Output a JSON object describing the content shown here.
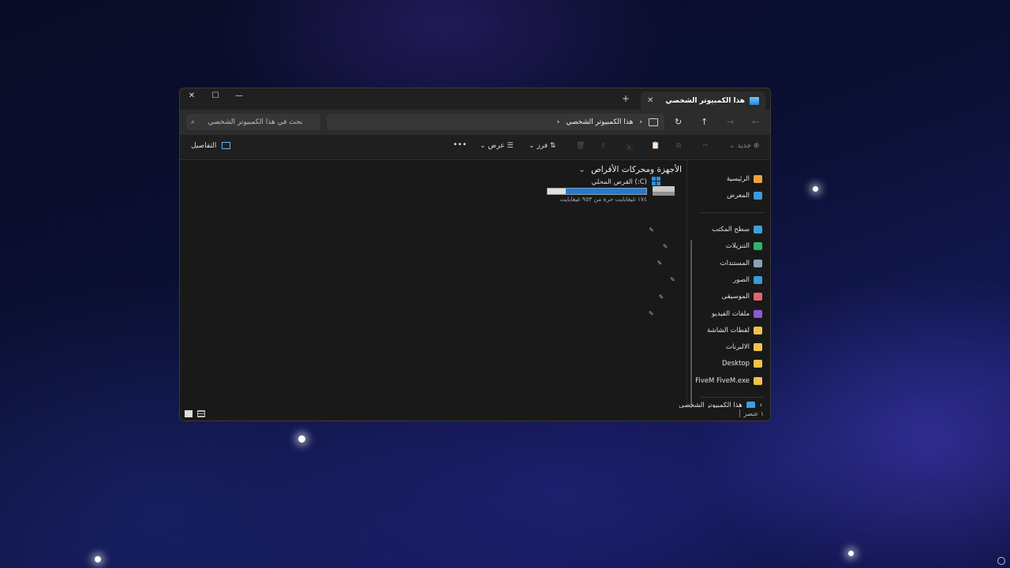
{
  "window": {
    "tab_title": "هذا الكمبيوتر الشخصي",
    "tab_close": "✕",
    "new_tab": "+",
    "controls": {
      "close": "✕",
      "maximize": "☐",
      "minimize": "—"
    }
  },
  "address": {
    "back": "←",
    "forward": "→",
    "up": "↑",
    "refresh": "↻",
    "path_segment": "هذا الكمبيوتر الشخصي",
    "chevron": "›",
    "expand_chevron": "›",
    "search_placeholder": "بحث في هذا الكمبيوتر الشخصي"
  },
  "commandbar": {
    "new_label": "جديد",
    "sort_label": "فرز",
    "view_label": "عرض",
    "more": "•••",
    "details_label": "التفاصيل"
  },
  "sidebar": {
    "quick": [
      {
        "label": "الرئيسية",
        "icon": "home-icon",
        "color": "#f0a040"
      },
      {
        "label": "المعرض",
        "icon": "gallery-icon",
        "color": "#3a9ad9"
      }
    ],
    "pinned": [
      {
        "label": "سطح المكتب",
        "icon": "desktop-icon",
        "color": "#3aa0e0",
        "pinned": true
      },
      {
        "label": "التنزيلات",
        "icon": "downloads-icon",
        "color": "#2fb36a",
        "pinned": true
      },
      {
        "label": "المستندات",
        "icon": "documents-icon",
        "color": "#8aa0b8",
        "pinned": true
      },
      {
        "label": "الصور",
        "icon": "pictures-icon",
        "color": "#3a9ad9",
        "pinned": true
      },
      {
        "label": "الموسيقى",
        "icon": "music-icon",
        "color": "#e0666a",
        "pinned": true
      },
      {
        "label": "ملفات الفيديو",
        "icon": "videos-icon",
        "color": "#8a5ad9",
        "pinned": true
      },
      {
        "label": "لقطات الشاشة",
        "icon": "folder-icon",
        "color": "#f2c14a",
        "pinned": false
      },
      {
        "label": "الالبرنات",
        "icon": "folder-icon",
        "color": "#f2c14a",
        "pinned": false
      },
      {
        "label": "Desktop",
        "icon": "folder-icon",
        "color": "#f2c14a",
        "pinned": false
      },
      {
        "label": "FiveM FiveM.exe",
        "icon": "folder-icon",
        "color": "#f2c14a",
        "pinned": false
      }
    ],
    "this_pc": "هذا الكمبيوتر الشخصي",
    "pin_glyph": "✎"
  },
  "content": {
    "section_header": "الأجهزة ومحركات الأقراص",
    "drive": {
      "name": "(C:) القرص المحلي",
      "free_text": "١٧٤ غيغابايت حرة من ٩٥٣ غيغابايت",
      "used_fraction": 0.82
    }
  },
  "status": {
    "item_count": "١ عنصر"
  },
  "colors": {
    "accent": "#1f7bd8",
    "window_bg": "#191919",
    "toolbar_bg": "#2c2c2c"
  }
}
